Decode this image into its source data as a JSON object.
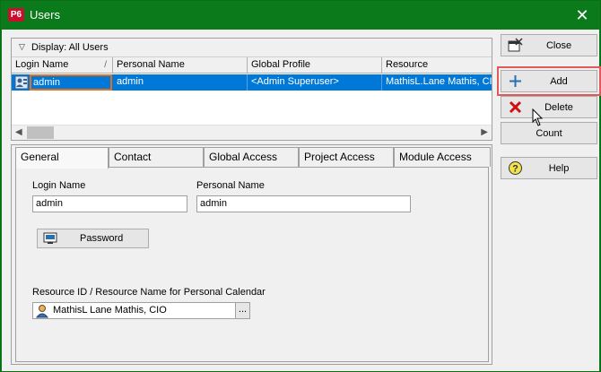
{
  "window": {
    "app_logo": "P6",
    "title": "Users",
    "close_glyph": "✕"
  },
  "users_list": {
    "display_label": "Display: All Users",
    "columns": [
      "Login Name",
      "Personal Name",
      "Global Profile",
      "Resource"
    ],
    "sort_marker": "/",
    "rows": [
      {
        "login_name": "admin",
        "personal_name": "admin",
        "global_profile": "<Admin Superuser>",
        "resource": "MathisL.Lane Mathis, CIO"
      }
    ]
  },
  "tabs": [
    "General",
    "Contact",
    "Global Access",
    "Project Access",
    "Module Access"
  ],
  "general": {
    "login_name_label": "Login Name",
    "login_name_value": "admin",
    "personal_name_label": "Personal Name",
    "personal_name_value": "admin",
    "password_button": "Password",
    "resource_label": "Resource ID / Resource Name for Personal Calendar",
    "resource_value": "MathisL  Lane Mathis, CIO",
    "resource_browse": "..."
  },
  "side_buttons": {
    "close": "Close",
    "add": "Add",
    "delete": "Delete",
    "count": "Count",
    "help": "Help"
  },
  "colors": {
    "titlebar": "#0b7a1a",
    "selection": "#0078d7",
    "highlight_outline": "#e05a5a"
  }
}
